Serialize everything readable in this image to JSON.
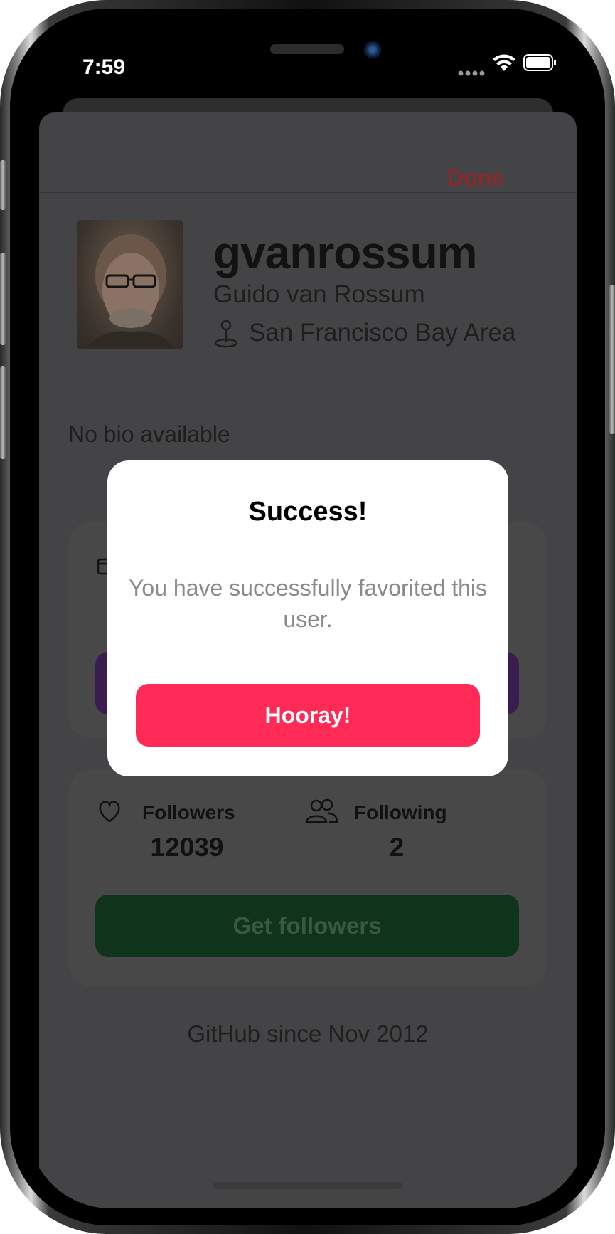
{
  "status_bar": {
    "time": "7:59"
  },
  "nav": {
    "done_label": "Done"
  },
  "profile": {
    "username": "gvanrossum",
    "full_name": "Guido van Rossum",
    "location": "San Francisco Bay Area",
    "bio": "No bio available"
  },
  "stats": {
    "followers_label": "Followers",
    "followers_count": "12039",
    "following_label": "Following",
    "following_count": "2",
    "get_followers_label": "Get followers"
  },
  "footer": {
    "since_text": "GitHub since Nov 2012"
  },
  "alert": {
    "title": "Success!",
    "message": "You have successfully favorited this user.",
    "button_label": "Hooray!"
  },
  "colors": {
    "accent": "#ff2a55",
    "done": "#8a2a2c",
    "get_followers": "#0f331b",
    "repos_button": "#3a1c4f"
  }
}
